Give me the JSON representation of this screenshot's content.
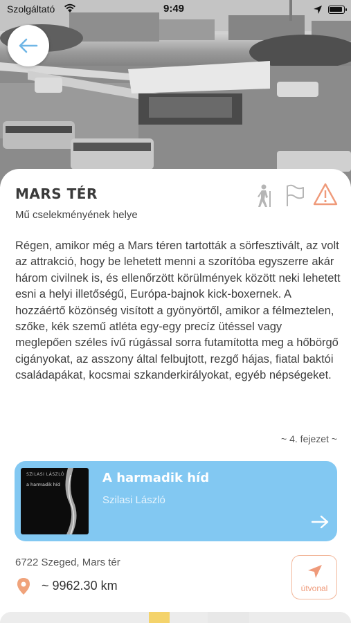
{
  "status_bar": {
    "carrier": "Szolgáltató",
    "time": "9:49",
    "wifi_icon": "wifi-icon",
    "location_icon": "location-arrow-icon",
    "battery_icon": "battery-icon"
  },
  "header": {
    "back_icon": "arrow-left-icon",
    "photo": "black-and-white photo of Mars tér bus station"
  },
  "place": {
    "title": "MARS TÉR",
    "subtitle": "Mű cselekményének helye",
    "icons": [
      "walking-person-icon",
      "flag-icon",
      "warning-icon"
    ]
  },
  "quote": {
    "text": "Régen, amikor még a Mars téren tartották a sörfesztivált, az volt az attrakció, hogy be lehetett menni a szorítóba egyszerre akár három civilnek is, és ellenőrzött körülmények között neki lehetett esni a helyi illetőségű, Európa-bajnok kick-boxernek. A hozzáértő közönség visított a gyönyörtől, amikor a félmeztelen, szőke, kék szemű atléta egy-egy precíz ütéssel vagy meglepően széles ívű rúgással sorra futamította meg a hőbörgő cigányokat, az asszony által felbujtott, rezgő hájas, fiatal baktói családapákat, kocsmai szkanderkirályokat, egyéb népségeket.",
    "chapter": "~ 4. fejezet ~"
  },
  "book": {
    "title": "A harmadik híd",
    "author": "Szilasi László",
    "cover_author": "SZILASI LÁSZLÓ",
    "cover_title": "a harmadik híd",
    "arrow_icon": "arrow-right-icon"
  },
  "location": {
    "address": "6722 Szeged, Mars tér",
    "distance": "~ 9962.30 km",
    "pin_icon": "map-pin-icon",
    "route_label": "útvonal",
    "route_icon": "navigation-arrow-icon"
  },
  "colors": {
    "accent_blue": "#82c8f2",
    "accent_orange": "#ef9a7a",
    "pin_orange": "#f0a37b"
  }
}
